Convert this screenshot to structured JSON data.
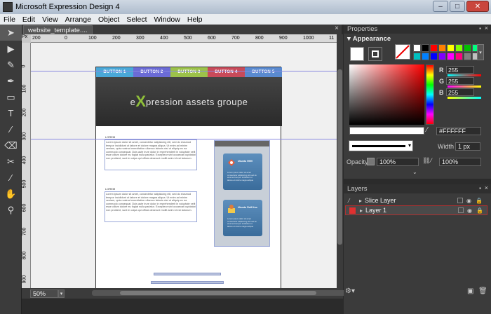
{
  "window": {
    "title": "Microsoft Expression Design 4",
    "controls": {
      "minimize": "–",
      "maximize": "□",
      "close": "✕"
    }
  },
  "menu": [
    "File",
    "Edit",
    "View",
    "Arrange",
    "Object",
    "Select",
    "Window",
    "Help"
  ],
  "tools": [
    {
      "icon": "selection-icon",
      "glyph": "➤"
    },
    {
      "icon": "direct-selection-icon",
      "glyph": "▶"
    },
    {
      "icon": "paintbrush-icon",
      "glyph": "✎"
    },
    {
      "icon": "pen-icon",
      "glyph": "✒"
    },
    {
      "icon": "rectangle-icon",
      "glyph": "▭"
    },
    {
      "icon": "text-icon",
      "glyph": "T"
    },
    {
      "icon": "gradient-icon",
      "glyph": "⁄"
    },
    {
      "icon": "eraser-icon",
      "glyph": "⌫"
    },
    {
      "icon": "scissors-icon",
      "glyph": "✂"
    },
    {
      "icon": "eyedropper-icon",
      "glyph": "⁄"
    },
    {
      "icon": "hand-icon",
      "glyph": "✋"
    },
    {
      "icon": "zoom-icon",
      "glyph": "⚲"
    }
  ],
  "document": {
    "tab_label": "website_template....",
    "close": "×"
  },
  "ruler": {
    "corner": "Px",
    "top_ticks": [
      "200",
      "0",
      "100",
      "200",
      "300",
      "400",
      "500",
      "600",
      "700",
      "800",
      "900",
      "1000",
      "11"
    ],
    "left_ticks": [
      "0",
      "100",
      "200",
      "300",
      "400",
      "500",
      "600",
      "700",
      "800",
      "900"
    ]
  },
  "artboard": {
    "nav": [
      {
        "label": "BUTTON 1",
        "color": "#4aa8d8"
      },
      {
        "label": "BUTTON 2",
        "color": "#6b6bd6"
      },
      {
        "label": "BUTTON 3",
        "color": "#9cc24a"
      },
      {
        "label": "BUTTON 4",
        "color": "#c84a5a"
      },
      {
        "label": "BUTTON 5",
        "color": "#5a8ad0"
      }
    ],
    "header_pre": "e",
    "header_x": "X",
    "header_post": "pression assets groupe",
    "lorem1_title": "LOREM",
    "lorem1_text": "Lorem ipsum dolor sit amet, consectetur adipisicing elit, sed do eiusmod tempor incididunt ut labore et dolore magna aliqua. Ut enim ad minim veniam, quis nostrud exercitation ullamco laboris nisi ut aliquip ex ea commodo consequat. Duis aute irure dolor in reprehenderit in voluptate velit esse cillum dolore eu fugiat nulla pariatur. Excepteur sint occaecat cupidatat non proident, sunt in culpa qui officia deserunt mollit anim id est laborum.",
    "lorem2_title": "LOREM",
    "lorem2_text": "Lorem ipsum dolor sit amet, consectetur adipisicing elit, sed do eiusmod tempor incididunt ut labore et dolore magna aliqua. Ut enim ad minim veniam, quis nostrud exercitation ullamco laboris nisi ut aliquip ex ea commodo consequat. Duis aute irure dolor in reprehenderit in voluptate velit esse cillum dolore eu fugiat nulla pariatur. Excepteur sint occaecat cupidatat non proident, sunt in culpa qui officia deserunt mollit anim id est laborum.",
    "card1_title": "Ubuntu 9999",
    "card1_text": "Lorem ipsum dolor sit amet consectetur adipisicing elit sed do eiusmod tempor incididunt ut labore et dolore magna aliqua",
    "card2_title": "Ubuntu Rolf Kuo",
    "card2_text": "Lorem ipsum dolor sit amet consectetur adipisicing elit sed do eiusmod tempor incididunt ut labore et dolore magna aliqua"
  },
  "status": {
    "zoom": "50%"
  },
  "properties": {
    "title": "Properties",
    "appearance": "Appearance",
    "r_label": "R",
    "r_value": "255",
    "g_label": "G",
    "g_value": "255",
    "b_label": "B",
    "b_value": "255",
    "hex": "#FFFFFF",
    "width_label": "Width",
    "width_value": "1 px",
    "opacity_label": "Opacity",
    "opacity_value": "100%",
    "fill_opacity_value": "100%",
    "palette": [
      "#ffffff",
      "#000000",
      "#ff0000",
      "#ff8000",
      "#ffff00",
      "#80ff00",
      "#00c000",
      "#00ff80",
      "#00c0c0",
      "#0080ff",
      "#0000ff",
      "#8000ff",
      "#ff00ff",
      "#ff0080",
      "#808080",
      "#c0c0c0"
    ]
  },
  "layers": {
    "title": "Layers",
    "items": [
      {
        "name": "Slice Layer",
        "selected": false
      },
      {
        "name": "Layer 1",
        "selected": true
      }
    ]
  }
}
